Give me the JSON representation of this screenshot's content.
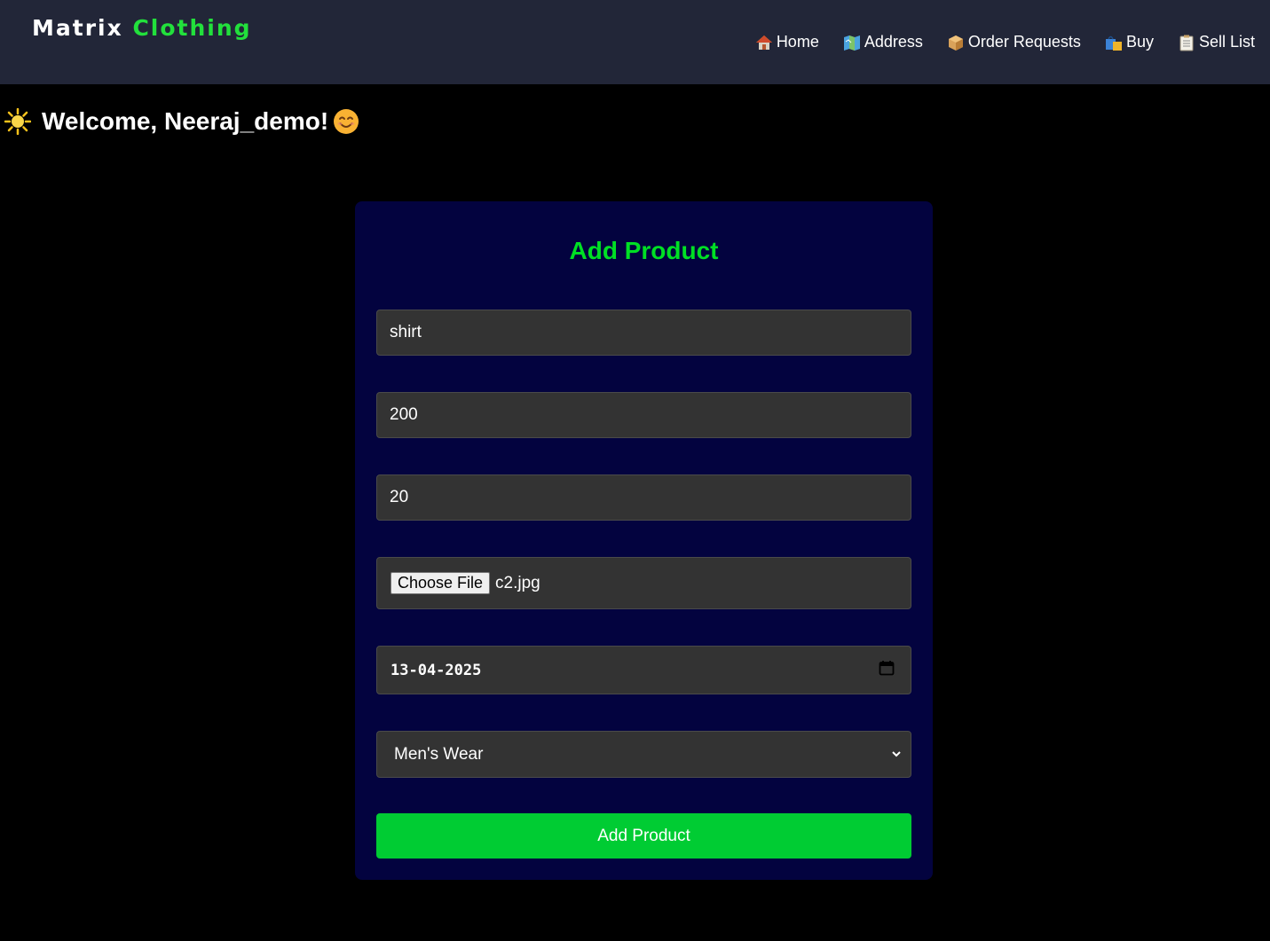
{
  "header": {
    "brand_part1": "Matrix",
    "brand_part2": "Clothing",
    "nav": [
      {
        "label": "Home",
        "icon": "house-icon"
      },
      {
        "label": "Address",
        "icon": "map-icon"
      },
      {
        "label": "Order Requests",
        "icon": "package-icon"
      },
      {
        "label": "Buy",
        "icon": "shopping-bags-icon"
      },
      {
        "label": "Sell List",
        "icon": "clipboard-icon"
      }
    ]
  },
  "welcome": {
    "text": "Welcome, Neeraj_demo!",
    "leading_icon": "sun-icon",
    "trailing_icon": "smiling-face-icon"
  },
  "form": {
    "title": "Add Product",
    "name_value": "shirt",
    "price_value": "200",
    "quantity_value": "20",
    "file_button_label": "Choose File",
    "file_name": "c2.jpg",
    "date_value": "13-04-2025",
    "category_value": "Men's Wear",
    "submit_label": "Add Product"
  },
  "colors": {
    "navbar_bg": "#222638",
    "accent_green": "#22e03c",
    "card_bg": "#03033f",
    "field_bg": "#333333",
    "button_bg": "#00cc33"
  }
}
